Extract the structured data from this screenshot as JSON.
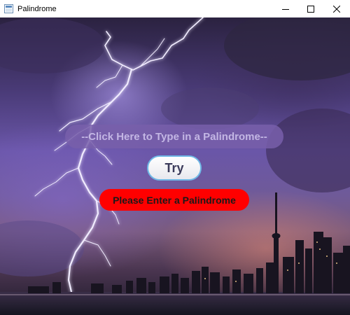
{
  "window": {
    "title": "Palindrome",
    "controls": {
      "minimize_icon": "minimize-icon",
      "maximize_icon": "maximize-icon",
      "close_icon": "close-icon"
    }
  },
  "form": {
    "input_placeholder": "--Click Here to Type in a Palindrome--",
    "input_value": "",
    "try_label": "Try",
    "status_message": "Please Enter a Palindrome"
  },
  "colors": {
    "status_background": "#ff0000",
    "button_border": "#6fb8e6",
    "input_background": "#785faa"
  }
}
